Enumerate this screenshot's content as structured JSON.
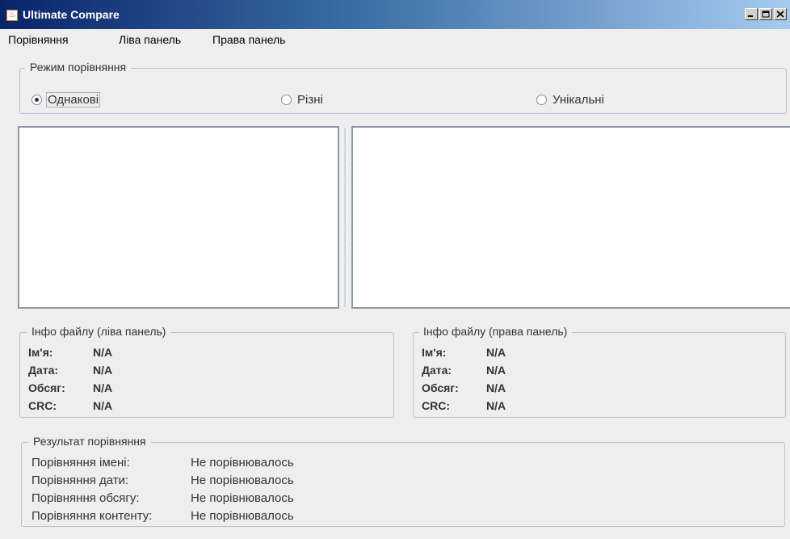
{
  "window": {
    "title": "Ultimate Compare",
    "controls": [
      "minimize-icon",
      "maximize-icon",
      "close-icon"
    ]
  },
  "menu": [
    "Порівняння",
    "Ліва панель",
    "Права панель"
  ],
  "mode": {
    "legend": "Режим порівняння",
    "options": [
      {
        "label": "Однакові",
        "checked": true
      },
      {
        "label": "Різні",
        "checked": false
      },
      {
        "label": "Унікальні",
        "checked": false
      }
    ]
  },
  "left_info": {
    "legend": "Інфо файлу (ліва панель)",
    "rows": [
      {
        "key": "Ім'я:",
        "value": "N/A"
      },
      {
        "key": "Дата:",
        "value": "N/A"
      },
      {
        "key": "Обсяг:",
        "value": "N/A"
      },
      {
        "key": "CRC:",
        "value": "N/A"
      }
    ]
  },
  "right_info": {
    "legend": "Інфо файлу (права панель)",
    "rows": [
      {
        "key": "Ім'я:",
        "value": "N/A"
      },
      {
        "key": "Дата:",
        "value": "N/A"
      },
      {
        "key": "Обсяг:",
        "value": "N/A"
      },
      {
        "key": "CRC:",
        "value": "N/A"
      }
    ]
  },
  "result": {
    "legend": "Результат порівняння",
    "rows": [
      {
        "key": "Порівняння імені:",
        "value": "Не порівнювалось"
      },
      {
        "key": "Порівняння дати:",
        "value": "Не порівнювалось"
      },
      {
        "key": "Порівняння обсягу:",
        "value": "Не порівнювалось"
      },
      {
        "key": "Порівняння контенту:",
        "value": "Не порівнювалось"
      }
    ]
  }
}
